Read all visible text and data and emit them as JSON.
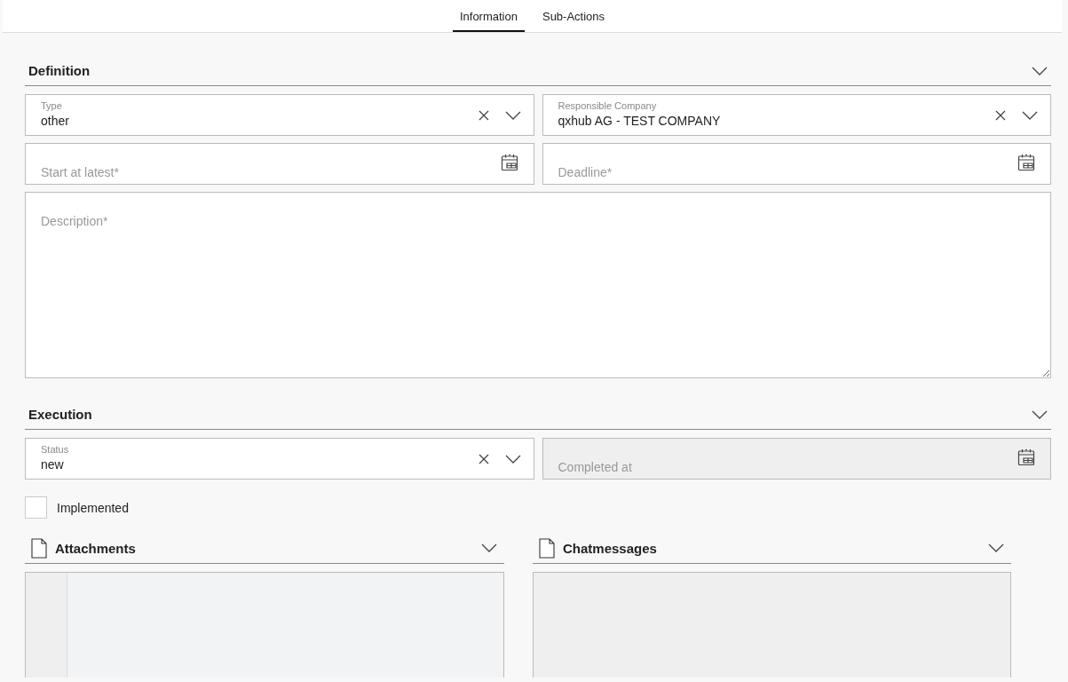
{
  "tabs": [
    {
      "label": "Information",
      "selected": true
    },
    {
      "label": "Sub-Actions",
      "selected": false
    }
  ],
  "sections": [
    {
      "title": "Definition",
      "expanded": true,
      "fields": [
        {
          "kind": "select",
          "label": "Type",
          "value": "other"
        },
        {
          "kind": "select",
          "label": "Responsible Company",
          "value": "qxhub AG - TEST COMPANY"
        },
        {
          "kind": "date",
          "placeholder": "Start at latest*",
          "disabled": false
        },
        {
          "kind": "date",
          "placeholder": "Deadline*",
          "disabled": false
        },
        {
          "kind": "textarea",
          "placeholder": "Description*"
        }
      ]
    },
    {
      "title": "Execution",
      "expanded": true,
      "fields": [
        {
          "kind": "select",
          "label": "Status",
          "value": "new"
        },
        {
          "kind": "date",
          "placeholder": "Completed at",
          "disabled": true
        }
      ]
    }
  ],
  "checkbox": {
    "label": "Implemented",
    "checked": false
  },
  "panels": [
    {
      "kind": "table",
      "title": "Attachments",
      "expanded": true
    },
    {
      "kind": "plain",
      "title": "Chatmessages",
      "expanded": true
    }
  ]
}
